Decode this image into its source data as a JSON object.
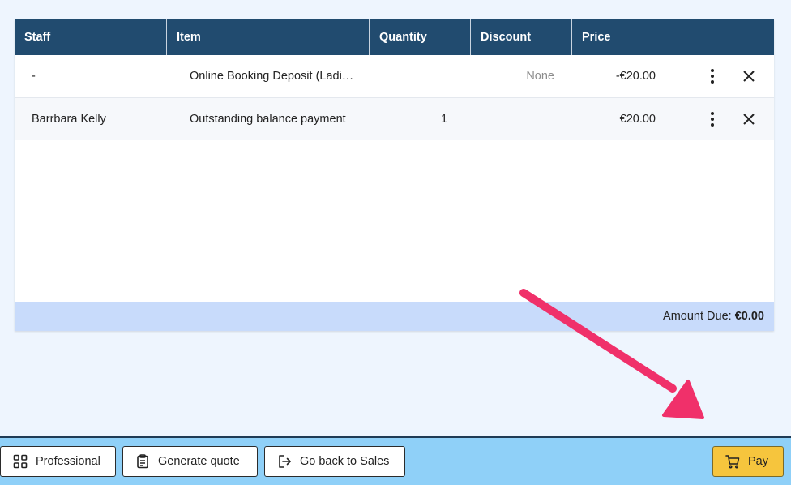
{
  "table": {
    "headers": [
      "Staff",
      "Item",
      "Quantity",
      "Discount",
      "Price",
      ""
    ],
    "rows": [
      {
        "staff": "-",
        "item": "Online Booking Deposit (Ladi…",
        "quantity": "",
        "discount": "None",
        "price": "-€20.00"
      },
      {
        "staff": "Barrbara Kelly",
        "item": "Outstanding balance payment",
        "quantity": "1",
        "discount": "",
        "price": "€20.00"
      }
    ],
    "amount_due_label": "Amount Due:",
    "amount_due_value": "€0.00"
  },
  "buttons": {
    "professional": "Professional",
    "quote": "Generate quote",
    "back": "Go back to Sales",
    "pay": "Pay"
  },
  "colors": {
    "header": "#214b6f",
    "arrow": "#f0306a",
    "pay": "#f6c53d",
    "bottombar": "#8fd0f8",
    "total_row": "#c8dbfb"
  },
  "icons": {
    "row_menu": "kebab-menu-icon",
    "row_remove": "close-icon",
    "professional": "grid-icon",
    "quote": "clipboard-icon",
    "back": "logout-arrow-icon",
    "pay": "cart-icon"
  }
}
